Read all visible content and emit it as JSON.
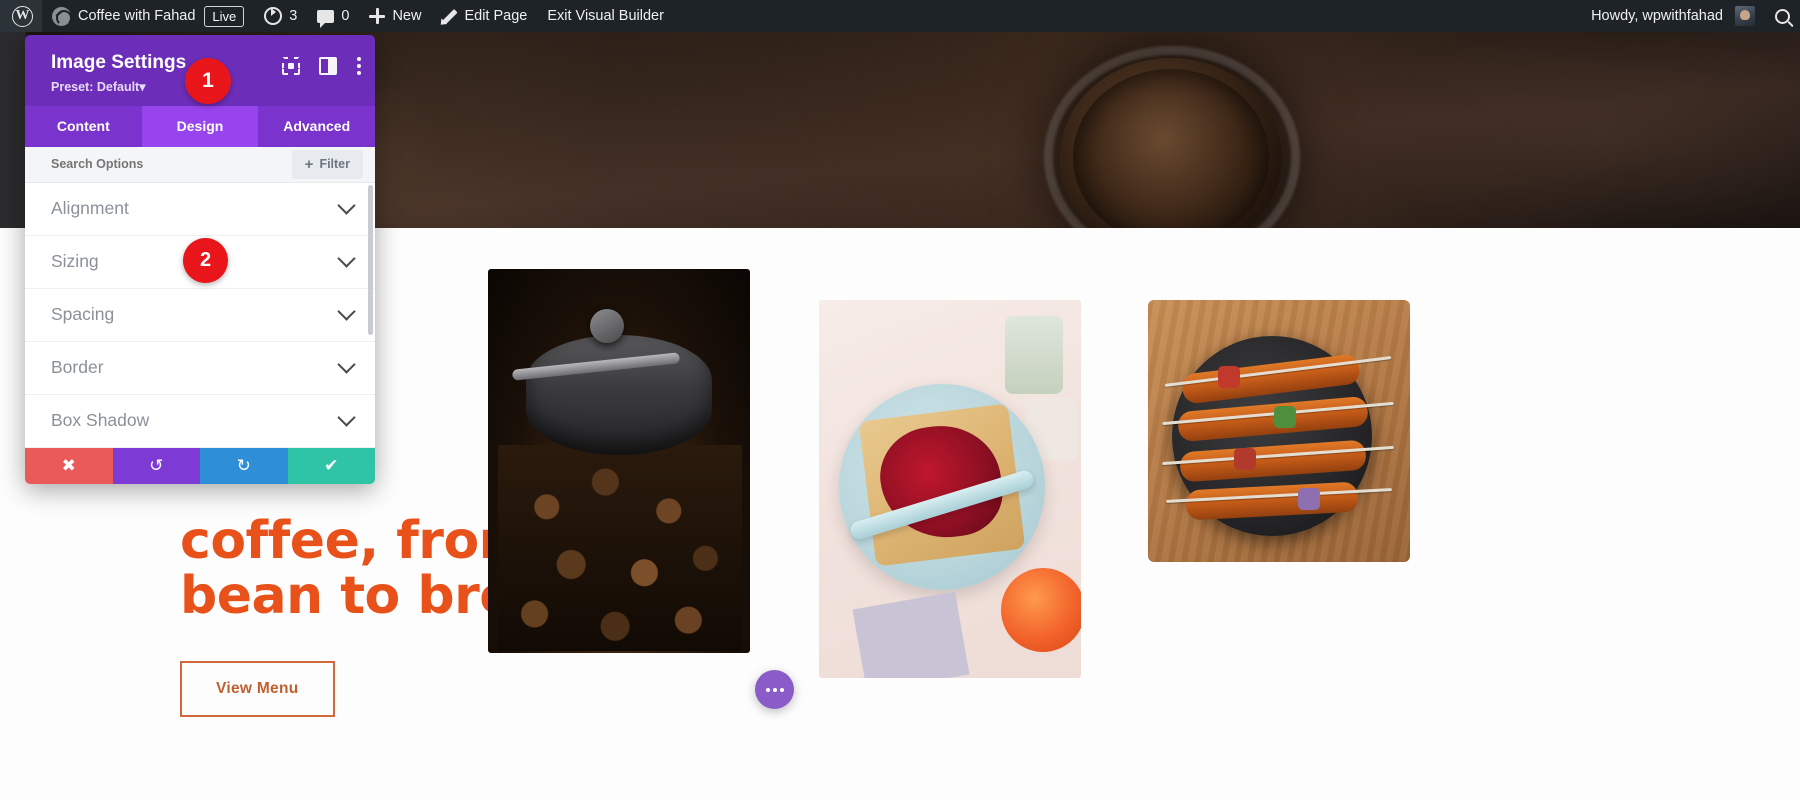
{
  "adminbar": {
    "wp_logo": "wordpress-logo-icon",
    "site_name": "Coffee with Fahad",
    "live_badge": "Live",
    "revisions_count": "3",
    "comments_count": "0",
    "new_label": "New",
    "edit_page_label": "Edit Page",
    "exit_builder_label": "Exit Visual Builder",
    "howdy": "Howdy, wpwithfahad",
    "search_icon": "search-icon"
  },
  "modal": {
    "title": "Image Settings",
    "preset": "Preset: Default",
    "preset_caret": "▾",
    "header_icons": [
      "focus-target-icon",
      "layout-panel-icon",
      "more-vertical-icon"
    ],
    "tabs": [
      {
        "label": "Content",
        "active": false
      },
      {
        "label": "Design",
        "active": true
      },
      {
        "label": "Advanced",
        "active": false
      }
    ],
    "search_placeholder": "Search Options",
    "search_value": "",
    "filter_label": "Filter",
    "filter_plus": "+",
    "options": [
      {
        "label": "Alignment"
      },
      {
        "label": "Sizing"
      },
      {
        "label": "Spacing"
      },
      {
        "label": "Border"
      },
      {
        "label": "Box Shadow"
      }
    ],
    "actions": [
      {
        "name": "close",
        "glyph": "✖"
      },
      {
        "name": "undo",
        "glyph": "↺"
      },
      {
        "name": "redo",
        "glyph": "↻"
      },
      {
        "name": "save",
        "glyph": "✔"
      }
    ],
    "colors": {
      "header_purple": "#6c2eb9",
      "tab_bar_purple": "#7a33cc",
      "tab_active_purple": "#9844ee",
      "badge_red": "#e8161a",
      "close_red": "#eb5a5a",
      "undo_purple": "#7e3ad4",
      "redo_blue": "#2e8ed6",
      "save_green": "#2ec4a5"
    }
  },
  "annotations": [
    {
      "id": "1",
      "text": "1"
    },
    {
      "id": "2",
      "text": "2"
    }
  ],
  "hero": {
    "headline_line1": "coffee, from",
    "headline_line2": "bean to brew.",
    "cta_label": "View Menu",
    "accent_color": "#e8511a",
    "cta_border_color": "#d0693a"
  },
  "gallery": [
    {
      "name": "coffee-beans-grinder-image",
      "alt": "Coffee grinder with roasted beans"
    },
    {
      "name": "jam-toast-image",
      "alt": "Toast with berry jam on blue plate"
    },
    {
      "name": "chicken-skewers-image",
      "alt": "Grilled chicken skewers in cast iron pan"
    }
  ],
  "fab": {
    "name": "page-settings-fab",
    "icon": "more-horizontal-icon",
    "color": "#8b5cc7"
  }
}
